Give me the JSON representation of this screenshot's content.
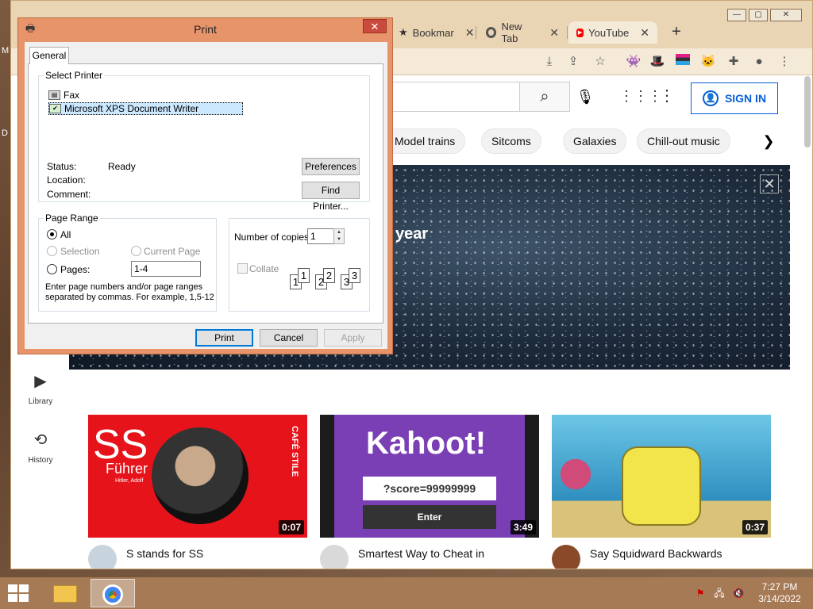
{
  "desktop": {
    "labels": [
      "M",
      "D"
    ]
  },
  "browser": {
    "tabs": [
      {
        "label": "Bookmar",
        "icon": "star-icon"
      },
      {
        "label": "New Tab",
        "icon": "chrome-icon"
      },
      {
        "label": "YouTube",
        "icon": "youtube-icon",
        "active": true
      }
    ],
    "new_tab": "+",
    "window_controls": [
      "—",
      "▢",
      "✕"
    ]
  },
  "youtube": {
    "sign_in": "SIGN IN",
    "chips": [
      "Model trains",
      "Sitcoms",
      "Galaxies",
      "Chill-out music"
    ],
    "banner_text": "year",
    "guide": [
      {
        "label": "Library",
        "icon": "library-icon"
      },
      {
        "label": "History",
        "icon": "history-icon"
      }
    ],
    "videos": [
      {
        "title": "S stands for SS",
        "duration": "0:07",
        "thumb_title": "SS",
        "thumb_sub": "Führer",
        "thumb_small": "Hitler, Adolf",
        "thumb_side": "CAFÉ STILE"
      },
      {
        "title": "Smartest Way to Cheat in",
        "duration": "3:49",
        "thumb_title": "Kahoot!",
        "thumb_field": "?score=99999999",
        "thumb_button": "Enter"
      },
      {
        "title": "Say Squidward Backwards",
        "duration": "0:37"
      }
    ]
  },
  "print_dialog": {
    "title": "Print",
    "close": "✕",
    "tab": "General",
    "select_printer_label": "Select Printer",
    "printers": [
      {
        "name": "Fax",
        "selected": false
      },
      {
        "name": "Microsoft XPS Document Writer",
        "selected": true
      }
    ],
    "status_label": "Status:",
    "status_value": "Ready",
    "location_label": "Location:",
    "comment_label": "Comment:",
    "preferences_button": "Preferences",
    "find_printer_button": "Find Printer...",
    "page_range_label": "Page Range",
    "range_all": "All",
    "range_selection": "Selection",
    "range_current": "Current Page",
    "range_pages": "Pages:",
    "pages_value": "1-4",
    "range_hint_line1": "Enter page numbers and/or page ranges",
    "range_hint_line2": "separated by commas.  For example, 1,5-12",
    "copies_label": "Number of copies:",
    "copies_value": "1",
    "collate_label": "Collate",
    "collate_pages": [
      "1",
      "1",
      "2",
      "2",
      "3",
      "3"
    ],
    "print_button": "Print",
    "cancel_button": "Cancel",
    "apply_button": "Apply"
  },
  "taskbar": {
    "time": "7:27 PM",
    "date": "3/14/2022"
  }
}
